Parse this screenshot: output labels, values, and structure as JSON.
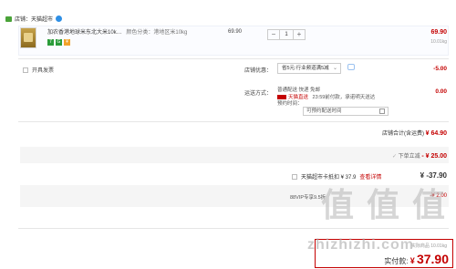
{
  "shop": {
    "label": "店铺：",
    "name": "天猫超市"
  },
  "item": {
    "title": "加农香港地球米东北大米10k…",
    "spec": "颜色分类：港地区米10kg",
    "unit_price": "69.90",
    "quantity": "1",
    "minus": "−",
    "plus": "+",
    "row_price": "69.90",
    "row_weight": "10.01kg",
    "badges": [
      "7",
      "G",
      "¥"
    ]
  },
  "invoice": {
    "label": "开具发票"
  },
  "discount": {
    "label": "店铺优惠：",
    "selected": "省5元:行业频道满5减",
    "amount": "-5.00"
  },
  "shipping": {
    "label": "运送方式：",
    "method": "普通配送 快递 免邮",
    "tmall_note": "天猫直送",
    "deadline": "23:59前付款，承诺明天送达",
    "time_label": "预约时间：",
    "time_placeholder": "可预约配送时间",
    "fee": "0.00"
  },
  "shop_total": {
    "label": "店铺合计(含运费)",
    "value": "¥ 64.90"
  },
  "discount_row": {
    "label": "下单立减",
    "value": "- ¥ 25.00"
  },
  "card_row": {
    "label": "天猫超市卡抵扣 ¥ 37.9",
    "link": "查看详情",
    "value": "¥ -37.90"
  },
  "vip_row": {
    "label": "88VIP专享9.5折",
    "value": "-¥ 2.00"
  },
  "watermark": {
    "text": "值 值 值",
    "site": "zhizhizhi.com"
  },
  "final": {
    "small": "实际商品 10.01kg",
    "label": "实付款:",
    "currency": "¥",
    "amount": "37.90"
  }
}
